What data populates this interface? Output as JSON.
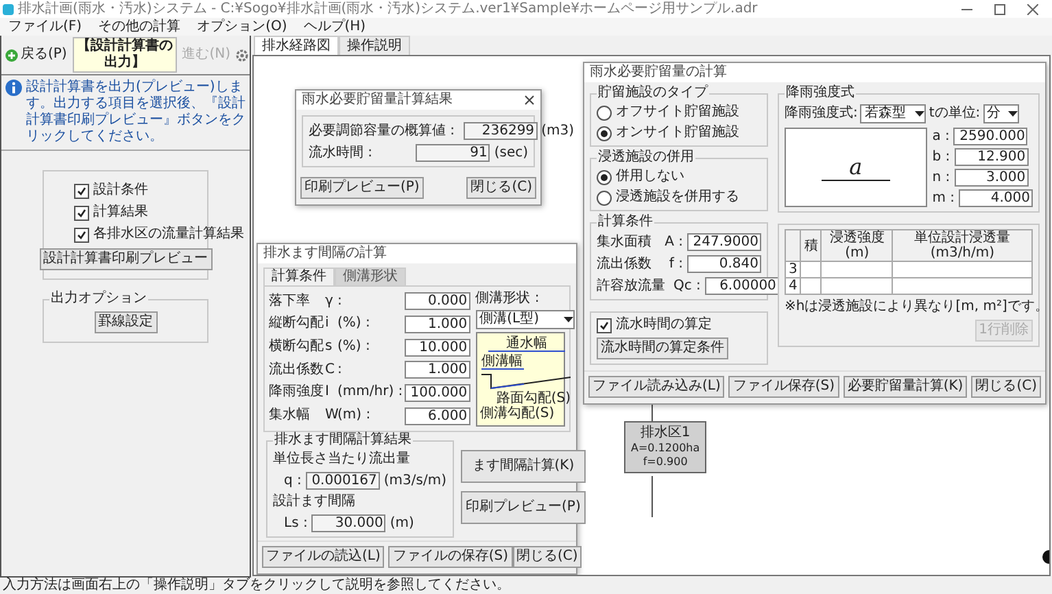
{
  "window": {
    "title": "排水計画(雨水・汚水)システム - C:¥Sogo¥排水計画(雨水・汚水)システム.ver1¥Sample¥ホームページ用サンプル.adr"
  },
  "menu": [
    "ファイル(F)",
    "その他の計算",
    "オプション(O)",
    "ヘルプ(H)"
  ],
  "left_panel": {
    "back": "戻る(P)",
    "heading": "【設計計算書の出力】",
    "forward": {
      "label": "進む(N)",
      "disabled": true
    },
    "info": "設計計算書を出力(プレビュー)します。出力する項目を選択後、『設計計算書印刷プレビュー』ボタンをクリックしてください。",
    "items": [
      {
        "label": "設計条件",
        "checked": true
      },
      {
        "label": "計算結果",
        "checked": true
      },
      {
        "label": "各排水区の流量計算結果",
        "checked": true
      }
    ],
    "preview_button": "設計計算書印刷プレビュー",
    "options": {
      "legend": "出力オプション",
      "button": "罫線設定"
    }
  },
  "tabs": [
    {
      "label": "排水経路図",
      "selected": true
    },
    {
      "label": "操作説明",
      "selected": false
    }
  ],
  "storage_dialog": {
    "title": "雨水必要貯留量の計算",
    "facility_type": {
      "legend": "貯留施設のタイプ",
      "options": [
        {
          "label": "オフサイト貯留施設",
          "selected": false
        },
        {
          "label": "オンサイト貯留施設",
          "selected": true
        }
      ]
    },
    "infiltration": {
      "legend": "浸透施設の併用",
      "options": [
        {
          "label": "併用しない",
          "selected": true
        },
        {
          "label": "浸透施設を併用する",
          "selected": false
        }
      ]
    },
    "conditions": {
      "legend": "計算条件",
      "rows": [
        {
          "label": "集水面積",
          "symbol": "A :",
          "value": "247.9000"
        },
        {
          "label": "流出係数",
          "symbol": "f :",
          "value": "0.840"
        },
        {
          "label": "許容放流量",
          "symbol": "Qc :",
          "value": "6.00000"
        }
      ]
    },
    "flow_time": {
      "label": "流水時間の算定",
      "checked": true,
      "button": "流水時間の算定条件"
    },
    "rainfall": {
      "legend": "降雨強度式",
      "formula_label": "降雨強度式:",
      "formula_value": "若森型",
      "unit_label": "tの単位:",
      "unit_value": "分",
      "numerator": "a",
      "params": [
        {
          "name": "a :",
          "value": "2590.000"
        },
        {
          "name": "b :",
          "value": "12.900"
        },
        {
          "name": "n :",
          "value": "3.000"
        },
        {
          "name": "m :",
          "value": "4.000"
        }
      ]
    },
    "table": {
      "columns": [
        "積",
        "浸透強度 (m)",
        "単位設計浸透量 (m3/h/m)"
      ],
      "rows": [
        "3",
        "4"
      ]
    },
    "note": "※hは浸透施設により異なり[m, m²]です。",
    "delete_button": {
      "label": "1行削除",
      "disabled": true
    },
    "footer_left": [
      "ファイル読み込み(L)",
      "ファイル保存(S)"
    ],
    "footer_right": [
      "必要貯留量計算(K)",
      "閉じる(C)"
    ]
  },
  "result_dialog": {
    "title": "雨水必要貯留量計算結果",
    "rows": [
      {
        "label": "必要調節容量の概算値 :",
        "value": "236299",
        "unit": "(m3)"
      },
      {
        "label": "流水時間 :",
        "value": "91",
        "unit": "(sec)"
      }
    ],
    "buttons": [
      "印刷プレビュー(P)",
      "閉じる(C)"
    ]
  },
  "inlet_dialog": {
    "title": "排水ます間隔の計算",
    "tabs": [
      {
        "label": "計算条件",
        "selected": true
      },
      {
        "label": "側溝形状",
        "selected": false
      }
    ],
    "rows": [
      {
        "label": "落下率",
        "symbol": "γ",
        "unit": ":",
        "value": "0.000"
      },
      {
        "label": "縦断勾配",
        "symbol": "i",
        "unit": "(%) :",
        "value": "1.000"
      },
      {
        "label": "横断勾配",
        "symbol": "s",
        "unit": "(%) :",
        "value": "10.000"
      },
      {
        "label": "流出係数",
        "symbol": "C",
        "unit": ":",
        "value": "1.000"
      },
      {
        "label": "降雨強度",
        "symbol": "I",
        "unit": "(mm/hr) :",
        "value": "100.000"
      },
      {
        "label": "集水幅",
        "symbol": "W",
        "unit": "(m) :",
        "value": "6.000"
      }
    ],
    "shape_label": "側溝形状 :",
    "shape_value": "側溝(L型)",
    "diagram_labels": [
      "通水幅",
      "側溝幅",
      "路面勾配(S)",
      "側溝勾配(S)"
    ],
    "results": {
      "legend": "排水ます間隔計算結果",
      "rows": [
        {
          "label": "単位長さ当たり流出量",
          "symbol": "q :",
          "value": "0.000167",
          "unit": "(m3/s/m)"
        },
        {
          "label": "設計ます間隔",
          "symbol": "Ls :",
          "value": "30.000",
          "unit": "(m)"
        }
      ]
    },
    "side_buttons": [
      "ます間隔計算(K)",
      "印刷プレビュー(P)"
    ],
    "footer_left": [
      "ファイルの読込(L)",
      "ファイルの保存(S)"
    ],
    "footer_right": "閉じる(C)"
  },
  "node": {
    "title": "排水区1",
    "lines": [
      "A=0.1200ha",
      "f=0.900"
    ]
  },
  "status_bar": "入力方法は画面右上の「操作説明」タブをクリックして説明を参照してください。"
}
